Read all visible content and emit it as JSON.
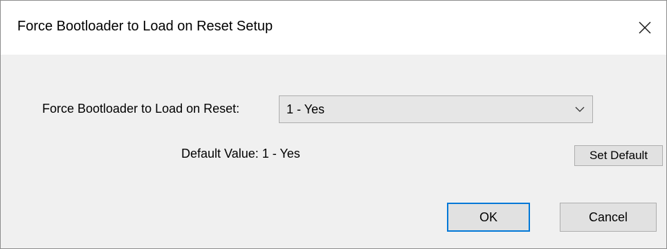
{
  "window": {
    "title": "Force Bootloader to Load on Reset Setup",
    "close_icon": "close-icon"
  },
  "form": {
    "field_label": "Force Bootloader to Load on Reset:",
    "select_value": "1 - Yes",
    "select_icon": "chevron-down-icon",
    "default_label": "Default Value: 1 - Yes",
    "set_default_label": "Set Default"
  },
  "buttons": {
    "ok_label": "OK",
    "cancel_label": "Cancel"
  },
  "colors": {
    "focus_border": "#0078d7",
    "dialog_background": "#f0f0f0",
    "titlebar_background": "#ffffff"
  }
}
